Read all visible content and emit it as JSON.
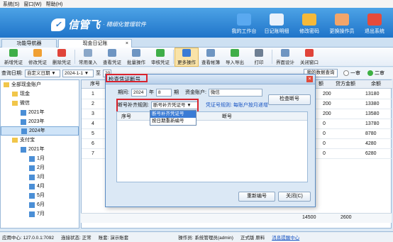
{
  "menubar": {
    "items": [
      "系统(S)",
      "窗口(W)",
      "帮助(H)"
    ]
  },
  "brand": {
    "name": "信管飞",
    "slogan": "· 精细化管理软件"
  },
  "header_tools": [
    {
      "label": "我的工作台",
      "color": "#5aa9f0"
    },
    {
      "label": "日记账明细",
      "color": "#e9f1fb"
    },
    {
      "label": "修改密码",
      "color": "#f5b93a"
    },
    {
      "label": "更换操作员",
      "color": "#f2a56a"
    },
    {
      "label": "退出系统",
      "color": "#e64b3b"
    }
  ],
  "tabs": [
    {
      "label": "功能导航器"
    },
    {
      "label": "现金日记账"
    }
  ],
  "tab_close": "×",
  "toolbar": [
    {
      "label": "新增凭证",
      "color": "#3fae49"
    },
    {
      "label": "修改凭证",
      "color": "#f0a033"
    },
    {
      "label": "删除凭证",
      "color": "#e0443a"
    },
    {
      "label": "常用录入",
      "color": "#8aa7c8"
    },
    {
      "label": "查看凭证",
      "color": "#6e95c2"
    },
    {
      "label": "批量操作",
      "color": "#6e95c2"
    },
    {
      "label": "审核凭证",
      "color": "#3fae49"
    },
    {
      "label": "更多操作",
      "color": "#3a7bd5"
    },
    {
      "label": "查看帐簿",
      "color": "#6e95c2"
    },
    {
      "label": "导入导出",
      "color": "#3fae49"
    },
    {
      "label": "打印",
      "color": "#6e7f93"
    },
    {
      "label": "界面设计",
      "color": "#6e95c2"
    },
    {
      "label": "关闭窗口",
      "color": "#e0443a"
    }
  ],
  "filter": {
    "date_label": "查询日期:",
    "date_mode": "自定义日期",
    "date_from": "2024-1-1",
    "to_label": "至",
    "date_to": "20",
    "dropdown_arrow": "▼",
    "query_button": "我的数据查询",
    "radio1": "一审",
    "radio2": "二审"
  },
  "tree": [
    {
      "label": "全部现金账户",
      "level": 0,
      "kind": "folder"
    },
    {
      "label": "现金",
      "level": 1,
      "kind": "folder"
    },
    {
      "label": "微信",
      "level": 1,
      "kind": "folder"
    },
    {
      "label": "2021年",
      "level": 2,
      "kind": "cal"
    },
    {
      "label": "2023年",
      "level": 2,
      "kind": "cal"
    },
    {
      "label": "2024年",
      "level": 2,
      "kind": "cal",
      "selected": true
    },
    {
      "label": "支付宝",
      "level": 1,
      "kind": "folder"
    },
    {
      "label": "2021年",
      "level": 2,
      "kind": "cal"
    },
    {
      "label": "1月",
      "level": 3,
      "kind": "cal"
    },
    {
      "label": "2月",
      "level": 3,
      "kind": "cal"
    },
    {
      "label": "3月",
      "level": 3,
      "kind": "cal"
    },
    {
      "label": "4月",
      "level": 3,
      "kind": "cal"
    },
    {
      "label": "5月",
      "level": 3,
      "kind": "cal"
    },
    {
      "label": "6月",
      "level": 3,
      "kind": "cal"
    },
    {
      "label": "7月",
      "level": 3,
      "kind": "cal"
    }
  ],
  "grid": {
    "col_index": "序号",
    "col_credit": "贷方金额",
    "col_balance": "余额",
    "col_debit_partial": "额",
    "rows": [
      {
        "n": "1",
        "debit": "200",
        "balance": "13180"
      },
      {
        "n": "2",
        "debit": "200",
        "balance": "13380"
      },
      {
        "n": "3",
        "debit": "200",
        "balance": "13580"
      },
      {
        "n": "4",
        "debit": "0",
        "balance": "13780"
      },
      {
        "n": "5",
        "debit": "0",
        "balance": "8780"
      },
      {
        "n": "6",
        "debit": "0",
        "balance": "4280"
      },
      {
        "n": "7",
        "debit": "0",
        "balance": "6280"
      }
    ],
    "totals": {
      "a": "14500",
      "b": "2600"
    }
  },
  "dialog": {
    "title": "检查凭证断号",
    "period_label": "期间:",
    "year": "2024",
    "year_unit": "年",
    "month": "8",
    "month_unit": "期",
    "account_label": "资金账户:",
    "account_value": "微信",
    "rule_label": "断号补齐规则:",
    "rule_value": "断号补齐凭证号",
    "rule_options": [
      "断号补齐凭证号",
      "按日期重新编号"
    ],
    "rule_hint": "凭证号规则: 每账户按月递增",
    "check_button": "检查断号",
    "table_col1": "序号",
    "table_col2": "断号",
    "renumber_button": "重新编号",
    "close_button": "关闭(C)"
  },
  "statusbar": {
    "app_center": "应用中心: 127.0.0.1:7092",
    "conn": "连接状态: 正常",
    "book": "账套: 演示账套",
    "operator": "操作员: 系统管理员(admin)",
    "edition": "正式版 原料",
    "link": "消息提醒中心"
  }
}
